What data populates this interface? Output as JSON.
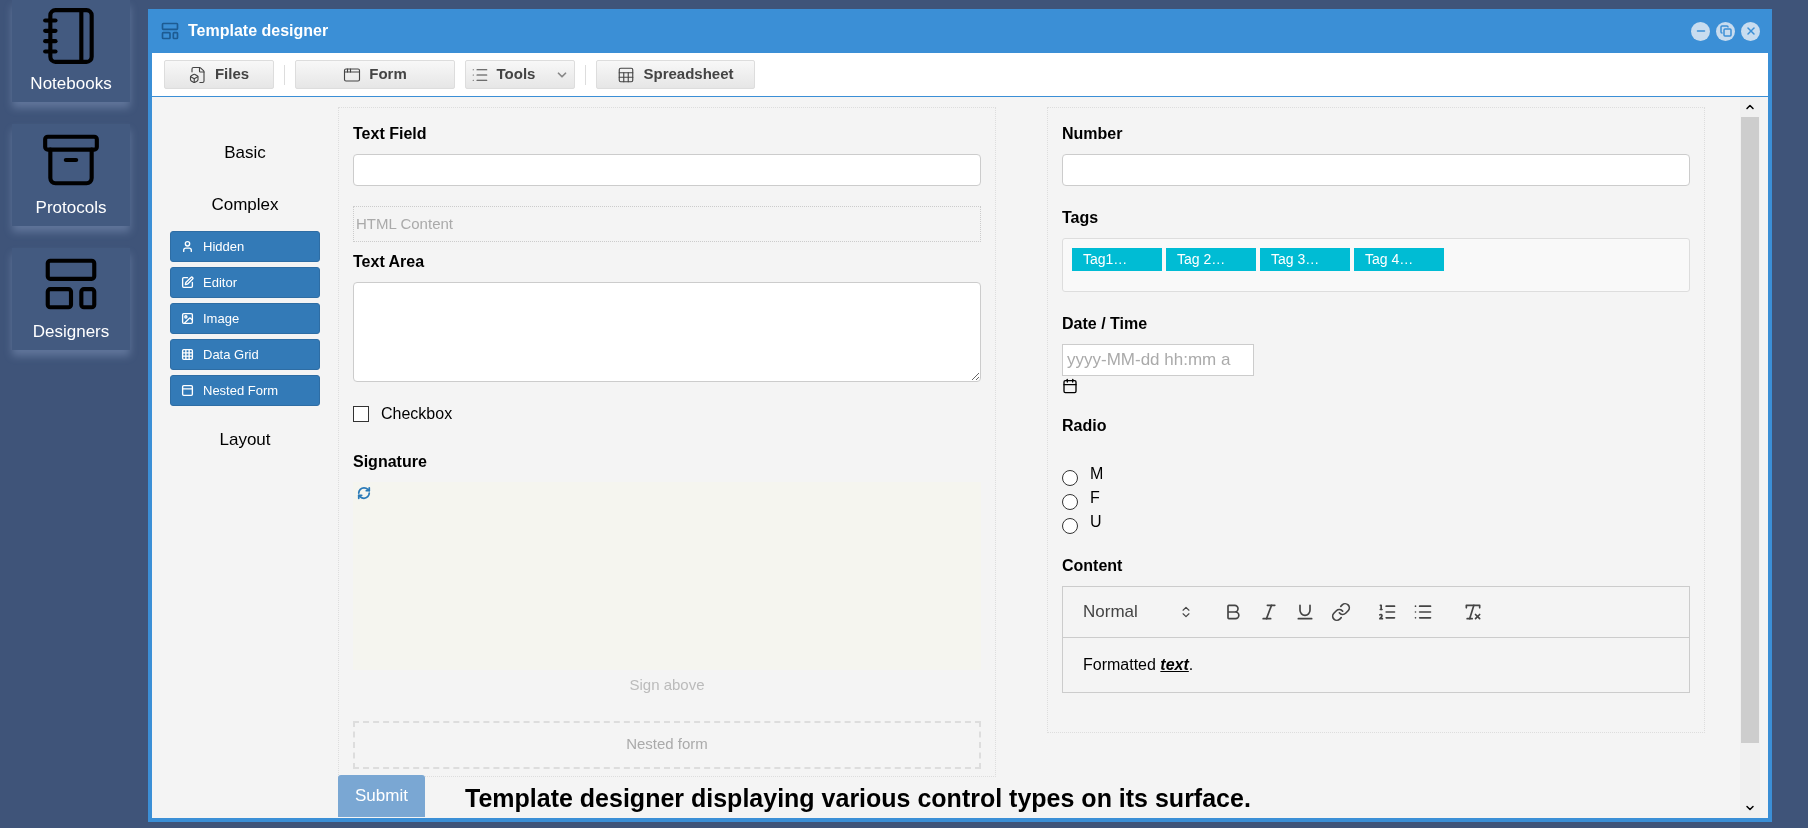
{
  "dock": [
    {
      "label": "Notebooks"
    },
    {
      "label": "Protocols"
    },
    {
      "label": "Designers"
    }
  ],
  "window": {
    "title": "Template designer"
  },
  "toolbar": [
    {
      "label": "Files",
      "kind": "button"
    },
    {
      "label": "Form",
      "kind": "button"
    },
    {
      "label": "Tools",
      "kind": "dropdown"
    },
    {
      "label": "Spreadsheet",
      "kind": "button"
    }
  ],
  "palette": [
    {
      "label": "Basic"
    },
    {
      "label": "Complex",
      "items": [
        "Hidden",
        "Editor",
        "Image",
        "Data Grid",
        "Nested Form"
      ]
    },
    {
      "label": "Layout"
    }
  ],
  "columns": [
    [
      {
        "kind": "text",
        "label": "Text Field"
      },
      {
        "kind": "html",
        "text": "HTML Content"
      },
      {
        "kind": "textarea",
        "label": "Text Area"
      },
      {
        "kind": "checkbox",
        "label": "Checkbox",
        "checked": false
      },
      {
        "kind": "signature",
        "label": "Signature",
        "hint": "Sign above"
      },
      {
        "kind": "nested",
        "text": "Nested form"
      }
    ],
    [
      {
        "kind": "text",
        "label": "Number"
      },
      {
        "kind": "tags",
        "label": "Tags",
        "tags": [
          "Tag1…",
          "Tag 2…",
          "Tag 3…",
          "Tag 4…"
        ]
      },
      {
        "kind": "datetime",
        "label": "Date / Time",
        "placeholder": "yyyy-MM-dd hh:mm a"
      },
      {
        "kind": "radio",
        "label": "Radio",
        "options": [
          {
            "label": "M",
            "selected": false
          },
          {
            "label": "F",
            "selected": false
          },
          {
            "label": "U",
            "selected": false
          }
        ]
      },
      {
        "kind": "editor",
        "label": "Content",
        "format": "Normal",
        "text": "Formatted **text**."
      }
    ]
  ],
  "submit": "Submit",
  "caption": "Template designer displaying various control types on its surface."
}
